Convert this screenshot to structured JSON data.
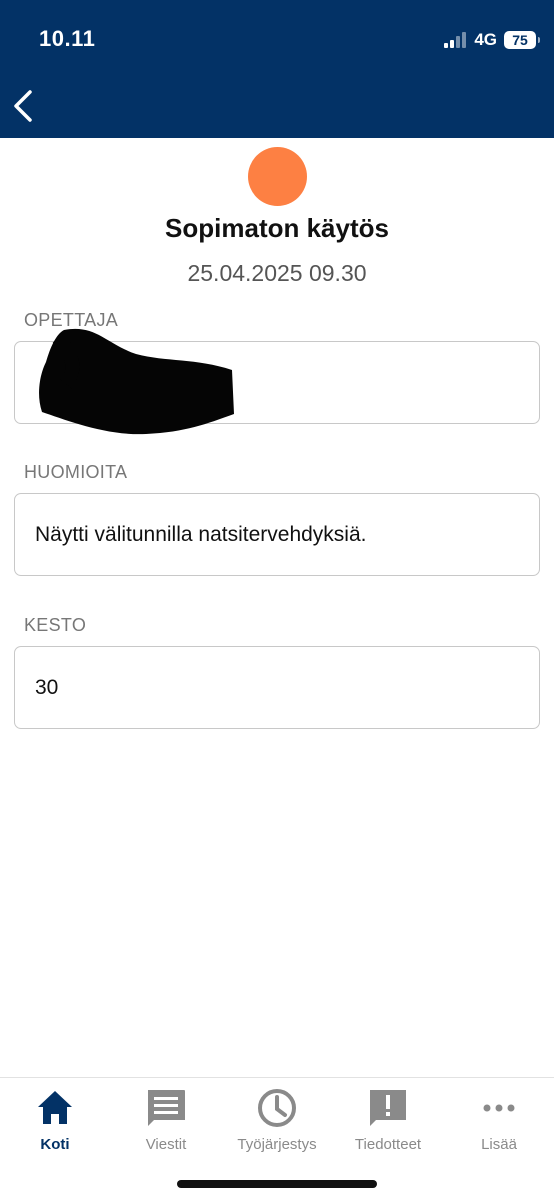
{
  "status_bar": {
    "time": "10.11",
    "network": "4G",
    "battery": "75"
  },
  "header": {
    "back_icon": "chevron-left-icon"
  },
  "entry": {
    "status_color": "#fd8043",
    "title": "Sopimaton käytös",
    "datetime": "25.04.2025 09.30"
  },
  "fields": {
    "teacher": {
      "label": "OPETTAJA",
      "value": ""
    },
    "notes": {
      "label": "HUOMIOITA",
      "value": "Näytti välitunnilla natsitervehdyksiä."
    },
    "duration": {
      "label": "KESTO",
      "value": "30"
    }
  },
  "nav": {
    "items": [
      {
        "label": "Koti",
        "icon": "home-icon",
        "active": true
      },
      {
        "label": "Viestit",
        "icon": "message-icon",
        "active": false
      },
      {
        "label": "Työjärjestys",
        "icon": "clock-icon",
        "active": false
      },
      {
        "label": "Tiedotteet",
        "icon": "alert-icon",
        "active": false
      },
      {
        "label": "Lisää",
        "icon": "more-icon",
        "active": false
      }
    ]
  },
  "colors": {
    "header_bg": "#033266",
    "active_nav": "#033266",
    "inactive_nav": "#8a8a8a"
  }
}
